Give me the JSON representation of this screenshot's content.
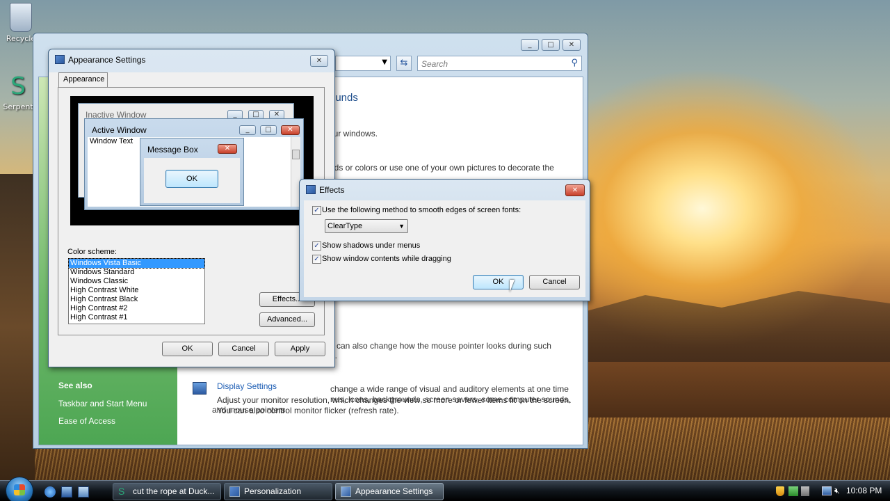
{
  "desktop": {
    "icons": [
      {
        "label": "Recycle"
      },
      {
        "label": "Serpent"
      }
    ]
  },
  "personalization": {
    "search_placeholder": "Search",
    "heading_fragment": "ounds",
    "lines": [
      "our windows.",
      "nds or colors or use one of your own pictures to decorate the",
      "u can also change how the mouse pointer looks during such",
      "g.",
      "change a wide range of visual and auditory elements at one time",
      "nus, icons, backgrounds, screen savers, some computer sounds,",
      "and mouse pointers."
    ],
    "see_also": {
      "title": "See also",
      "items": [
        "Taskbar and Start Menu",
        "Ease of Access"
      ]
    },
    "display_settings": {
      "link": "Display Settings",
      "desc1": "Adjust your monitor resolution, which changes the view so more or fewer items fit on the screen.",
      "desc2": "You can also control monitor flicker (refresh rate)."
    }
  },
  "appearance_dialog": {
    "title": "Appearance Settings",
    "tab": "Appearance",
    "preview": {
      "inactive_window": "Inactive Window",
      "active_window": "Active Window",
      "window_text": "Window Text",
      "message_box": "Message Box",
      "ok": "OK"
    },
    "color_scheme_label": "Color scheme:",
    "color_schemes": [
      "Windows Vista Basic",
      "Windows Standard",
      "Windows Classic",
      "High Contrast White",
      "High Contrast Black",
      "High Contrast #2",
      "High Contrast #1"
    ],
    "selected_scheme": "Windows Vista Basic",
    "effects_button": "Effects...",
    "advanced_button": "Advanced...",
    "ok": "OK",
    "cancel": "Cancel",
    "apply": "Apply"
  },
  "effects_dialog": {
    "title": "Effects",
    "smooth_label": "Use the following method to smooth edges of screen fonts:",
    "smooth_checked": true,
    "smooth_method": "ClearType",
    "shadows_label": "Show shadows under menus",
    "shadows_checked": true,
    "drag_label": "Show window contents while dragging",
    "drag_checked": true,
    "ok": "OK",
    "cancel": "Cancel"
  },
  "taskbar": {
    "buttons": [
      {
        "label": "cut the rope at Duck..."
      },
      {
        "label": "Personalization"
      },
      {
        "label": "Appearance Settings"
      }
    ],
    "clock": "10:08 PM"
  },
  "colors": {
    "accent": "#3399ff",
    "link": "#1e5eb4",
    "see_also_green": "#4da653"
  }
}
